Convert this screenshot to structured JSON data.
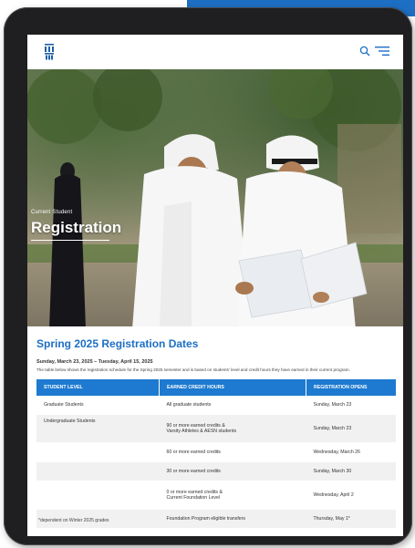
{
  "hero": {
    "eyebrow": "Current Student",
    "title": "Registration"
  },
  "section": {
    "title": "Spring 2025 Registration Dates",
    "date_range": "Sunday, March 23, 2025 – Tuesday, April 15, 2025",
    "intro": "The table below shows the registration schedule for the Spring 2025 semester and is based on students' level and credit hours they have earned in their current program."
  },
  "table": {
    "headers": [
      "STUDENT LEVEL",
      "EARNED CREDIT HOURS",
      "REGISTRATION OPENS"
    ],
    "rows": [
      {
        "level": "Graduate Students",
        "hours": "All graduate students",
        "hours2": "",
        "opens": "Sunday, March 23"
      },
      {
        "level": "Undergraduate Students",
        "hours": "90 or more earned credits &",
        "hours2": "Varsity Athletes & AESN students",
        "opens": "Sunday, March 23"
      },
      {
        "level": "",
        "hours": "60 or more earned credits",
        "hours2": "",
        "opens": "Wednesday, March 26"
      },
      {
        "level": "",
        "hours": "30 or more earned credits",
        "hours2": "",
        "opens": "Sunday, March 30"
      },
      {
        "level": "",
        "hours": "0 or more earned credits &",
        "hours2": "Current Foundation Level",
        "opens": "Wednesday, April 2"
      },
      {
        "level": "",
        "hours": "Foundation Program eligible transfers",
        "hours2": "",
        "opens": "Thursday, May 1*"
      }
    ]
  },
  "footnote": "*dependent on Winter 2025 grades",
  "icons": {
    "logo": "university-logo-icon",
    "search": "search-icon",
    "menu": "menu-icon"
  },
  "colors": {
    "accent": "#1d6fc4",
    "table_header": "#1d7ad0",
    "row_alt": "#f1f1f1"
  }
}
